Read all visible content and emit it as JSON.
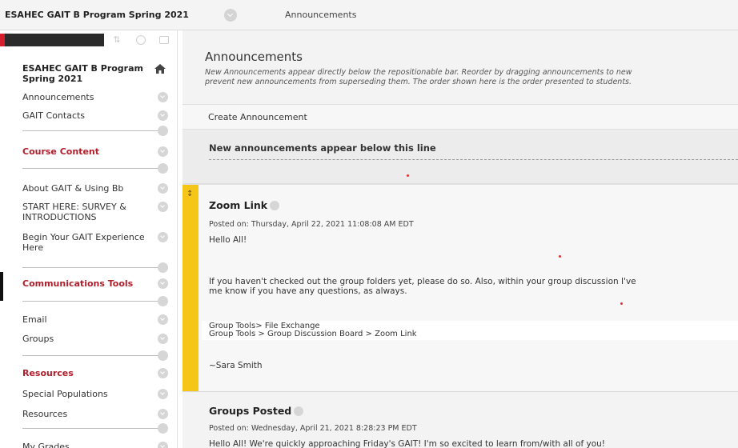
{
  "breadcrumb": {
    "course": "ESAHEC GAIT B Program Spring 2021",
    "page": "Announcements"
  },
  "sidebar": {
    "course_title": "ESAHEC GAIT B Program Spring 2021",
    "items": [
      {
        "label": "Announcements"
      },
      {
        "label": "GAIT Contacts"
      },
      {
        "label": "Course Content"
      },
      {
        "label": "About GAIT & Using Bb"
      },
      {
        "label": "START HERE: SURVEY & INTRODUCTIONS"
      },
      {
        "label": "Begin Your GAIT Experience Here"
      },
      {
        "label": "Communications Tools"
      },
      {
        "label": "Email"
      },
      {
        "label": "Groups"
      },
      {
        "label": "Resources"
      },
      {
        "label": "Special Populations"
      },
      {
        "label": "Resources"
      },
      {
        "label": "My Grades"
      }
    ]
  },
  "main": {
    "title": "Announcements",
    "description_line1": "New Announcements appear directly below the repositionable bar. Reorder by dragging announcements to new",
    "description_line2": "prevent new announcements from superseding them. The order shown here is the order presented to students.",
    "create_label": "Create Announcement",
    "reposition_text": "New announcements appear below this line"
  },
  "announcements": [
    {
      "title": "Zoom Link",
      "posted": "Posted on: Thursday, April 22, 2021 11:08:08 AM EDT",
      "greeting": "Hello All!",
      "body_line1": "If you haven't checked out the group folders yet, please do so. Also, within your group discussion I've",
      "body_line2": "me know if you have any questions, as always.",
      "tools_line1": "Group Tools> File Exchange",
      "tools_line2": "Group Tools > Group Discussion Board > Zoom Link",
      "signature": "~Sara Smith"
    },
    {
      "title": "Groups Posted",
      "posted": "Posted on: Wednesday, April 21, 2021 8:28:23 PM EDT",
      "body_line1": "Hello All! We're quickly approaching Friday's GAIT! I'm so excited to learn from/with all of you!"
    }
  ],
  "colors": {
    "accent_red": "#b01e2b",
    "highlight_yellow": "#f5c518",
    "menu_bar_dark": "#2b2b2b"
  },
  "icons": {
    "home": "home-icon",
    "chevron": "chevron-down-icon",
    "move": "move-handle-icon"
  }
}
